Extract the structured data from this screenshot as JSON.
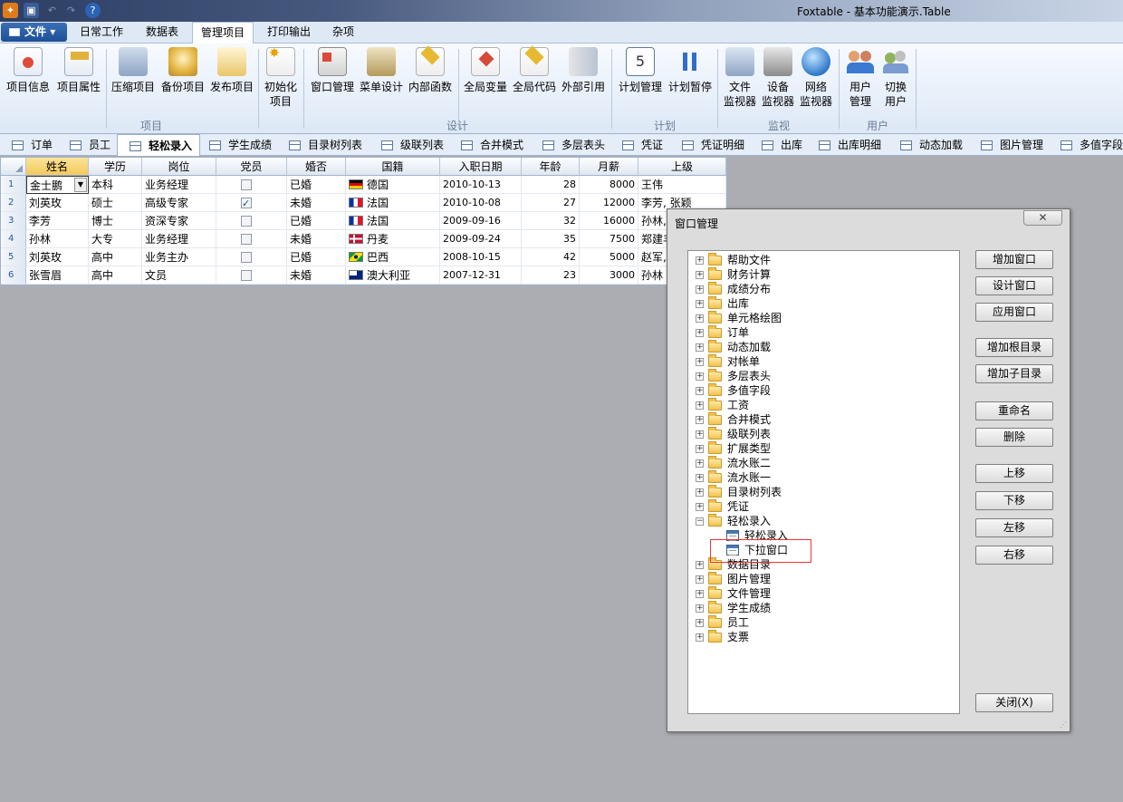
{
  "window": {
    "title": "Foxtable - 基本功能演示.Table"
  },
  "menu": {
    "file_label": "文件",
    "tabs": [
      "日常工作",
      "数据表",
      "管理项目",
      "打印输出",
      "杂项"
    ],
    "active_tab": "管理项目"
  },
  "ribbon": {
    "buttons": [
      {
        "label": "项目信息",
        "icon": "ribbon-medal-doc-icon"
      },
      {
        "label": "项目属性",
        "icon": "ribbon-hand-doc-icon"
      },
      {
        "label": "压缩项目",
        "icon": "ribbon-compress-icon"
      },
      {
        "label": "备份项目",
        "icon": "ribbon-backup-icon"
      },
      {
        "label": "发布项目",
        "icon": "ribbon-publish-icon"
      },
      {
        "label": "初始化项目",
        "line1": "初始化",
        "line2": "项目",
        "icon": "ribbon-init-icon"
      },
      {
        "label": "窗口管理",
        "icon": "ribbon-window-icon"
      },
      {
        "label": "菜单设计",
        "icon": "ribbon-tools-icon"
      },
      {
        "label": "内部函数",
        "icon": "ribbon-function-icon"
      },
      {
        "label": "全局变量",
        "icon": "ribbon-variable-icon"
      },
      {
        "label": "全局代码",
        "icon": "ribbon-code-icon"
      },
      {
        "label": "外部引用",
        "icon": "ribbon-reference-icon"
      },
      {
        "label": "计划管理",
        "icon": "ribbon-calendar-icon"
      },
      {
        "label": "计划暂停",
        "icon": "ribbon-pause-icon"
      },
      {
        "label": "文件监视器",
        "line1": "文件",
        "line2": "监视器",
        "icon": "ribbon-file-monitor-icon"
      },
      {
        "label": "设备监视器",
        "line1": "设备",
        "line2": "监视器",
        "icon": "ribbon-device-monitor-icon"
      },
      {
        "label": "网络监视器",
        "line1": "网络",
        "line2": "监视器",
        "icon": "ribbon-globe-icon"
      },
      {
        "label": "用户管理",
        "line1": "用户",
        "line2": "管理",
        "icon": "ribbon-users-icon"
      },
      {
        "label": "切换用户",
        "line1": "切换",
        "line2": "用户",
        "icon": "ribbon-switch-user-icon"
      }
    ],
    "groups": [
      "项目",
      "设计",
      "计划",
      "监视",
      "用户"
    ]
  },
  "table_tabs": [
    "订单",
    "员工",
    "轻松录入",
    "学生成绩",
    "目录树列表",
    "级联列表",
    "合并模式",
    "多层表头",
    "凭证",
    "凭证明细",
    "出库",
    "出库明细",
    "动态加载",
    "图片管理",
    "多值字段"
  ],
  "active_table_tab": "轻松录入",
  "grid": {
    "columns": [
      "姓名",
      "学历",
      "岗位",
      "党员",
      "婚否",
      "国籍",
      "入职日期",
      "年龄",
      "月薪",
      "上级"
    ],
    "rows": [
      {
        "no": "1",
        "name": "金士鹏",
        "edu": "本科",
        "post": "业务经理",
        "party": false,
        "married": "已婚",
        "nation": "德国",
        "date": "2010-10-13",
        "age": "28",
        "salary": "8000",
        "boss": "王伟"
      },
      {
        "no": "2",
        "name": "刘英玫",
        "edu": "硕士",
        "post": "高级专家",
        "party": true,
        "married": "未婚",
        "nation": "法国",
        "date": "2010-10-08",
        "age": "27",
        "salary": "12000",
        "boss": "李芳, 张颖"
      },
      {
        "no": "3",
        "name": "李芳",
        "edu": "博士",
        "post": "资深专家",
        "party": false,
        "married": "已婚",
        "nation": "法国",
        "date": "2009-09-16",
        "age": "32",
        "salary": "16000",
        "boss": "孙林, "
      },
      {
        "no": "4",
        "name": "孙林",
        "edu": "大专",
        "post": "业务经理",
        "party": false,
        "married": "未婚",
        "nation": "丹麦",
        "date": "2009-09-24",
        "age": "35",
        "salary": "7500",
        "boss": "郑建丰"
      },
      {
        "no": "5",
        "name": "刘英玫",
        "edu": "高中",
        "post": "业务主办",
        "party": false,
        "married": "已婚",
        "nation": "巴西",
        "date": "2008-10-15",
        "age": "42",
        "salary": "5000",
        "boss": "赵军, "
      },
      {
        "no": "6",
        "name": "张雪眉",
        "edu": "高中",
        "post": "文员",
        "party": false,
        "married": "未婚",
        "nation": "澳大利亚",
        "date": "2007-12-31",
        "age": "23",
        "salary": "3000",
        "boss": "孙林"
      }
    ]
  },
  "dialog": {
    "title": "窗口管理",
    "close_glyph": "✕",
    "tree": [
      "帮助文件",
      "财务计算",
      "成绩分布",
      "出库",
      "单元格绘图",
      "订单",
      "动态加载",
      "对帐单",
      "多层表头",
      "多值字段",
      "工资",
      "合并模式",
      "级联列表",
      "扩展类型",
      "流水账二",
      "流水账一",
      "目录树列表",
      "凭证",
      "轻松录入",
      "轻松录入",
      "下拉窗口",
      "数据目录",
      "图片管理",
      "文件管理",
      "学生成绩",
      "员工",
      "支票"
    ],
    "buttons": {
      "add_window": "增加窗口",
      "design_window": "设计窗口",
      "apply_window": "应用窗口",
      "add_root": "增加根目录",
      "add_child": "增加子目录",
      "rename": "重命名",
      "delete": "删除",
      "move_up": "上移",
      "move_down": "下移",
      "move_left": "左移",
      "move_right": "右移",
      "close": "关闭(X)"
    }
  },
  "colors": {
    "accent": "#1d4f96",
    "highlight_box": "#e33333",
    "ribbon_bg": "#dde8f6"
  }
}
